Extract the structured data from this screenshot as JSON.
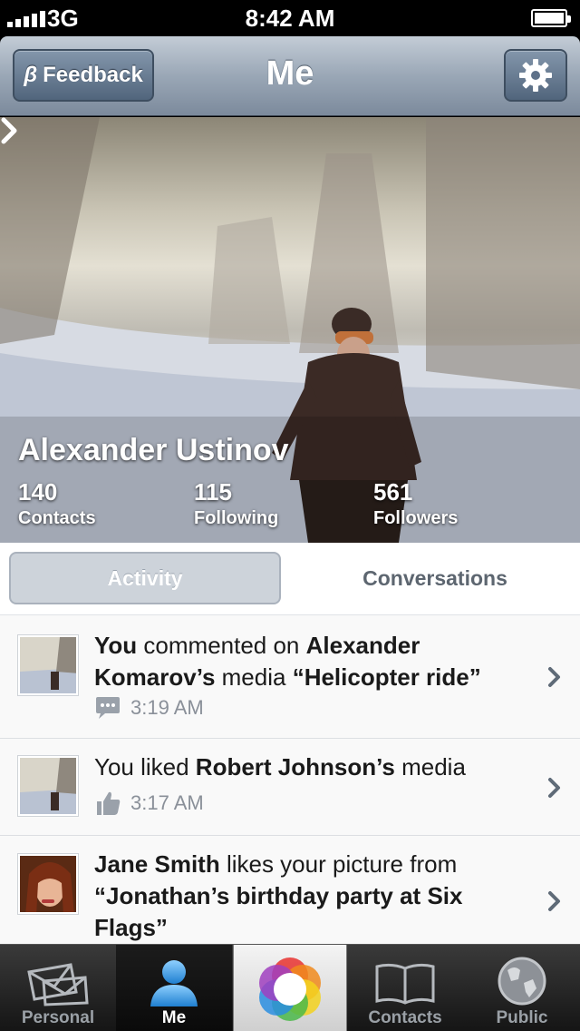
{
  "status_bar": {
    "carrier": "3G",
    "time": "8:42 AM",
    "battery_level": 1.0
  },
  "nav": {
    "title": "Me",
    "feedback_beta": "β",
    "feedback_label": "Feedback",
    "settings_icon": "gear-icon"
  },
  "profile": {
    "name": "Alexander Ustinov",
    "stats": [
      {
        "value": "140",
        "label": "Contacts"
      },
      {
        "value": "115",
        "label": "Following"
      },
      {
        "value": "561",
        "label": "Followers"
      }
    ]
  },
  "tabs": {
    "activity": "Activity",
    "conversations": "Conversations",
    "selected": "Activity"
  },
  "feed": [
    {
      "time": "3:19 AM",
      "icon": "comment-icon"
    },
    {
      "time": "3:17 AM",
      "icon": "thumbs-up-icon"
    },
    {}
  ],
  "feed_text": {
    "item0": {
      "actor": "You",
      "verb": " commented on ",
      "target": "Alexander Komarov’s",
      "mid": " media ",
      "quote": "“Helicopter ride”"
    },
    "item1": {
      "prefix": "You liked ",
      "target": "Robert Johnson’s",
      "suffix": " media"
    },
    "item2": {
      "actor": "Jane Smith",
      "verb": " likes your picture from ",
      "quote": "“Jonathan’s birthday party at Six Flags”"
    }
  },
  "tab_bar": [
    {
      "label": "Personal",
      "icon": "envelopes-icon"
    },
    {
      "label": "Me",
      "icon": "person-icon",
      "active": true
    },
    {
      "label": "",
      "icon": "color-ring-icon"
    },
    {
      "label": "Contacts",
      "icon": "book-icon"
    },
    {
      "label": "Public",
      "icon": "globe-icon"
    }
  ],
  "colors": {
    "nav_gradient_top": "#c3ccd6",
    "nav_gradient_bottom": "#7c8a9c",
    "active_tab": "#cdd3da",
    "tabbar_active_icon": "#3aa0e8"
  }
}
